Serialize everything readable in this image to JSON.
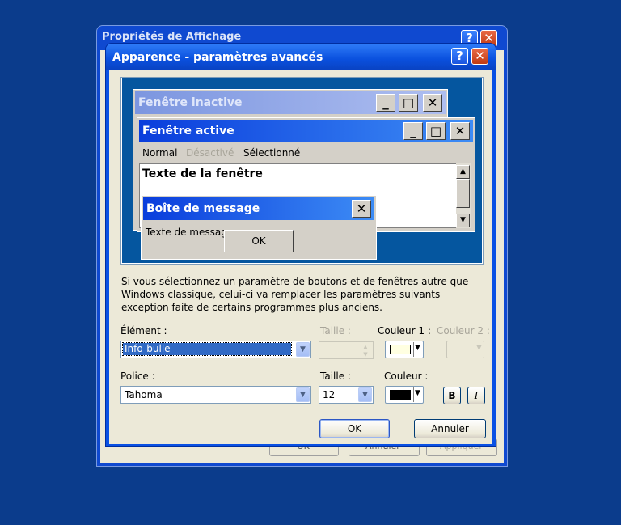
{
  "background_window": {
    "title": "Propriétés de Affichage",
    "buttons": [
      "OK",
      "Annuler",
      "Appliquer"
    ]
  },
  "dialog": {
    "title": "Apparence - paramètres avancés",
    "help_glyph": "?",
    "close_glyph": "✕"
  },
  "preview": {
    "inactive_title": "Fenêtre inactive",
    "active_title": "Fenêtre active",
    "menu": [
      "Normal",
      "Désactivé",
      "Sélectionné"
    ],
    "window_text": "Texte de la fenêtre",
    "message_title": "Boîte de message",
    "message_text": "Texte de messag",
    "message_ok": "OK",
    "min_glyph": "_",
    "max_glyph": "□",
    "close_glyph": "✕",
    "scroll_up": "▲",
    "scroll_down": "▼"
  },
  "description": "Si vous sélectionnez un paramètre de boutons et de fenêtres autre que Windows classique, celui-ci va remplacer les paramètres suivants exception faite de certains programmes plus anciens.",
  "element": {
    "label": "Élément :",
    "value": "Info-bulle",
    "size_label": "Taille :",
    "size_value": "",
    "color1_label": "Couleur 1 :",
    "color1_value": "#ffffe1",
    "color2_label": "Couleur 2 :"
  },
  "font": {
    "label": "Police :",
    "value": "Tahoma",
    "size_label": "Taille :",
    "size_value": "12",
    "color_label": "Couleur :",
    "color_value": "#000000",
    "bold_glyph": "B",
    "italic_glyph": "I"
  },
  "buttons": {
    "ok": "OK",
    "cancel": "Annuler"
  },
  "colors": {
    "desktop": "#0b3c8c",
    "title_active": "#0a50de",
    "selection": "#316ac5"
  }
}
